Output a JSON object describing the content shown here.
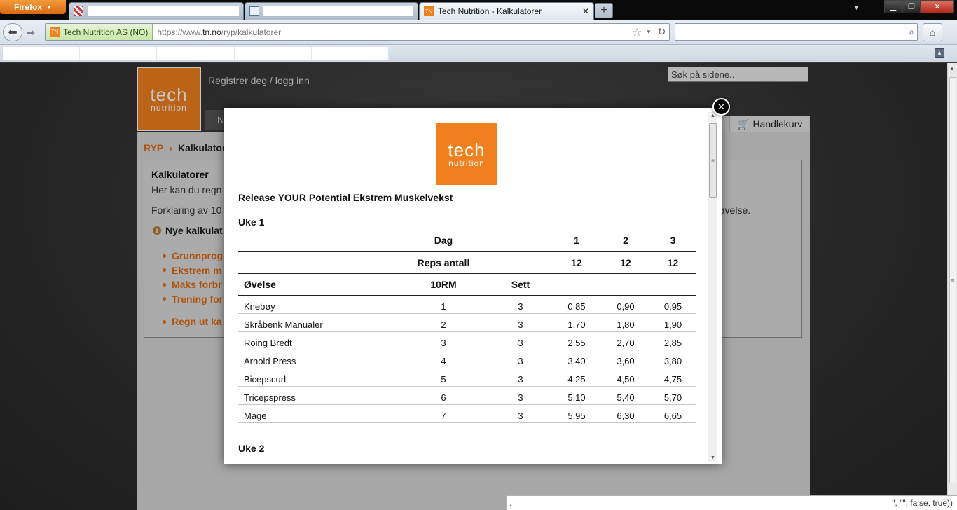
{
  "browser": {
    "menu_button": "Firefox",
    "tabs": [
      {
        "title": "",
        "icon": "stripes-favicon-icon"
      },
      {
        "title": "",
        "icon": "document-favicon-icon"
      },
      {
        "title": "Tech Nutrition - Kalkulatorer",
        "icon": "tn-favicon-icon",
        "close": "✕",
        "active": true
      }
    ],
    "new_tab": "+",
    "favicon_text": "TN",
    "identity": "Tech Nutrition AS (NO)",
    "url_prefix": "https://www.",
    "url_domain": "tn.no",
    "url_path": "/ryp/kalkulatorer",
    "search_value": "",
    "status_left": ".",
    "status_right": "\", \"\", false, true))"
  },
  "site": {
    "logo_word": "tech",
    "logo_sub": "nutrition",
    "register_link": "Registrer deg / logg inn",
    "search_placeholder": "Søk på sidene..",
    "nav_first": "N",
    "cart": "Handlekurv",
    "breadcrumb": {
      "root": "RYP",
      "sep": "›",
      "current": "Kalkulator"
    },
    "box": {
      "title": "Kalkulatorer",
      "intro": "Her kan du regn",
      "explanation": "Forklaring av 10",
      "explanation_end": "øvelse.",
      "note": "Nye kalkulat",
      "links": [
        "Grunnprog",
        "Ekstrem m",
        "Maks forbr",
        "Trening for"
      ],
      "extra_link": "Regn ut ka"
    }
  },
  "modal": {
    "close": "✕",
    "heading": "Release YOUR Potential Ekstrem Muskelvekst",
    "week1": "Uke 1",
    "week2": "Uke 2",
    "table": {
      "day_label": "Dag",
      "days": [
        "1",
        "2",
        "3"
      ],
      "reps_label": "Reps antall",
      "reps": [
        "12",
        "12",
        "12"
      ],
      "col_exercise": "Øvelse",
      "col_10rm": "10RM",
      "col_sets": "Sett",
      "rows": [
        {
          "name": "Knebøy",
          "rm": "1",
          "sets": "3",
          "d1": "0,85",
          "d2": "0,90",
          "d3": "0,95"
        },
        {
          "name": "Skråbenk Manualer",
          "rm": "2",
          "sets": "3",
          "d1": "1,70",
          "d2": "1,80",
          "d3": "1,90"
        },
        {
          "name": "Roing Bredt",
          "rm": "3",
          "sets": "3",
          "d1": "2,55",
          "d2": "2,70",
          "d3": "2,85"
        },
        {
          "name": "Arnold Press",
          "rm": "4",
          "sets": "3",
          "d1": "3,40",
          "d2": "3,60",
          "d3": "3,80"
        },
        {
          "name": "Bicepscurl",
          "rm": "5",
          "sets": "3",
          "d1": "4,25",
          "d2": "4,50",
          "d3": "4,75"
        },
        {
          "name": "Tricepspress",
          "rm": "6",
          "sets": "3",
          "d1": "5,10",
          "d2": "5,40",
          "d3": "5,70"
        },
        {
          "name": "Mage",
          "rm": "7",
          "sets": "3",
          "d1": "5,95",
          "d2": "6,30",
          "d3": "6,65"
        }
      ]
    }
  },
  "colors": {
    "brand_orange": "#f07f1d",
    "link_orange": "#e06c12"
  }
}
